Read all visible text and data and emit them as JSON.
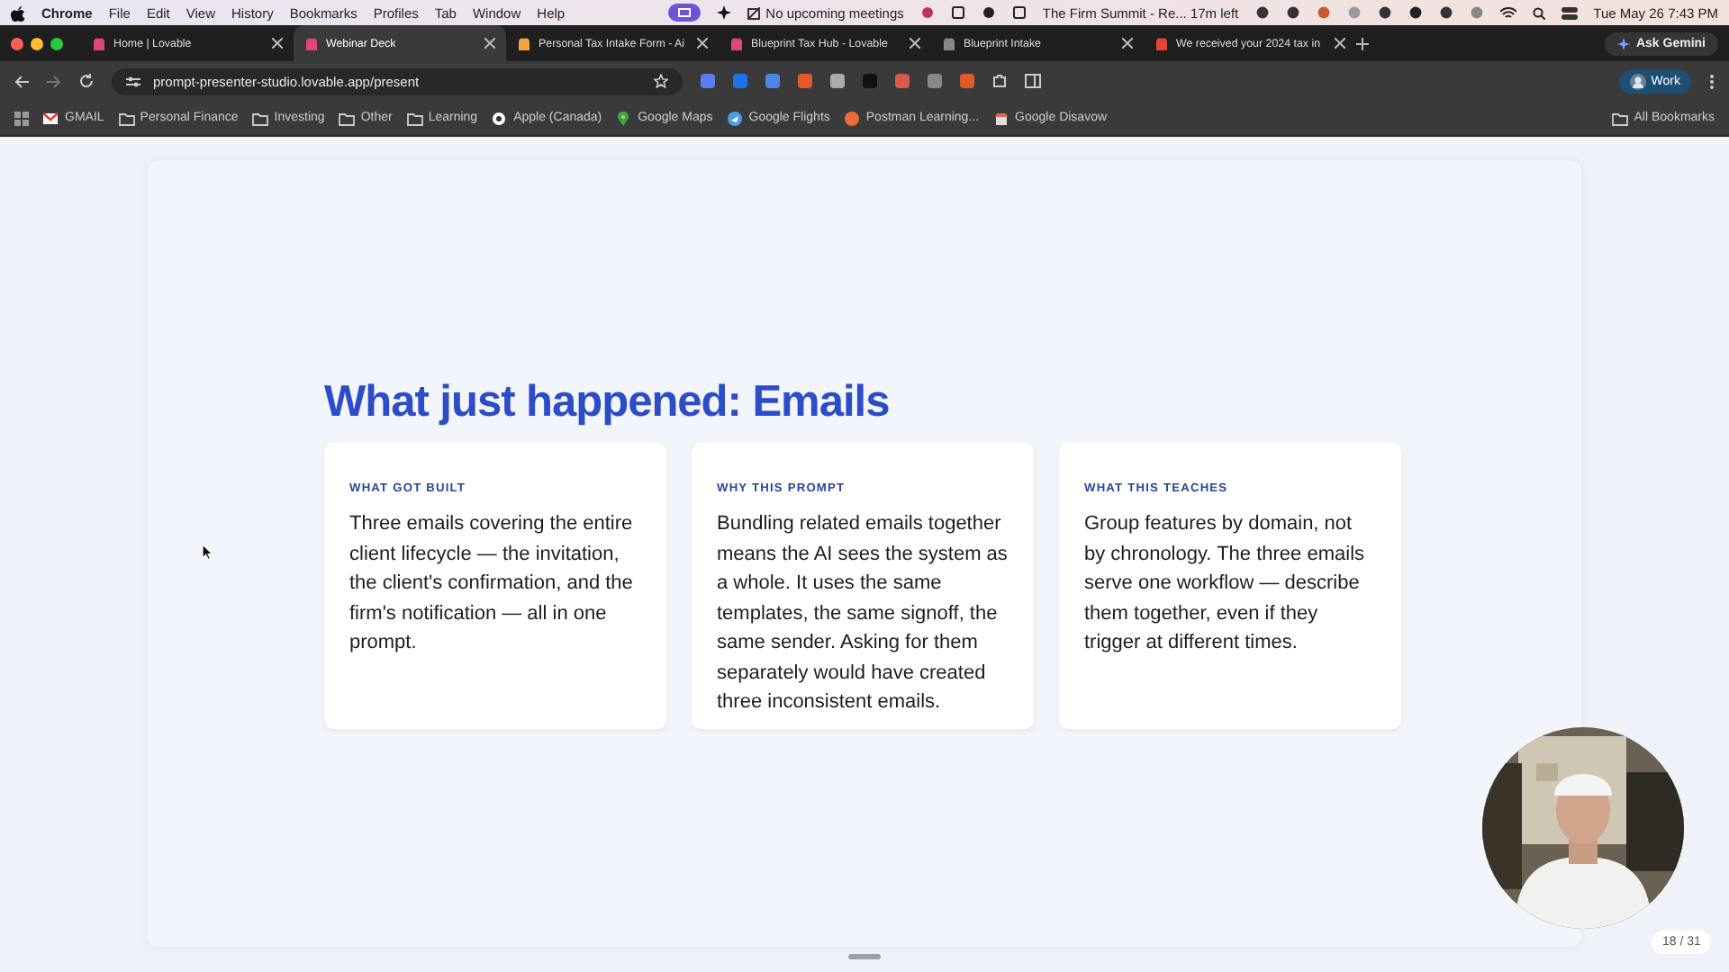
{
  "menu_bar": {
    "app": "Chrome",
    "items": [
      "File",
      "Edit",
      "View",
      "History",
      "Bookmarks",
      "Profiles",
      "Tab",
      "Window",
      "Help"
    ],
    "meeting": "No upcoming meetings",
    "event": "The Firm Summit - Re... 17m left",
    "datetime": "Tue May 26  7:43 PM"
  },
  "tabs": [
    {
      "title": "Home | Lovable",
      "selected": false
    },
    {
      "title": "Webinar Deck",
      "selected": true
    },
    {
      "title": "Personal Tax Intake Form - Ai",
      "selected": false
    },
    {
      "title": "Blueprint Tax Hub - Lovable",
      "selected": false
    },
    {
      "title": "Blueprint Intake",
      "selected": false
    },
    {
      "title": "We received your 2024 tax in",
      "selected": false
    }
  ],
  "ask_gemini": "Ask Gemini",
  "address_bar": {
    "url": "prompt-presenter-studio.lovable.app/present",
    "profile": "Work"
  },
  "bookmarks": [
    "GMAIL",
    "Personal Finance",
    "Investing",
    "Other",
    "Learning",
    "Apple (Canada)",
    "Google Maps",
    "Google Flights",
    "Postman Learning...",
    "Google Disavow"
  ],
  "all_bookmarks": "All Bookmarks",
  "slide": {
    "title": "What just happened: Emails",
    "cards": [
      {
        "heading": "WHAT GOT BUILT",
        "body": "Three emails covering the entire client lifecycle — the invitation, the client's confirmation, and the firm's notification — all in one prompt."
      },
      {
        "heading": "WHY THIS PROMPT",
        "body": "Bundling related emails together means the AI sees the system as a whole. It uses the same templates, the same signoff, the same sender. Asking for them separately would have created three inconsistent emails."
      },
      {
        "heading": "WHAT THIS TEACHES",
        "body": "Group features by domain, not by chronology. The three emails serve one workflow — describe them together, even if they trigger at different times."
      }
    ],
    "page": "18 / 31"
  }
}
